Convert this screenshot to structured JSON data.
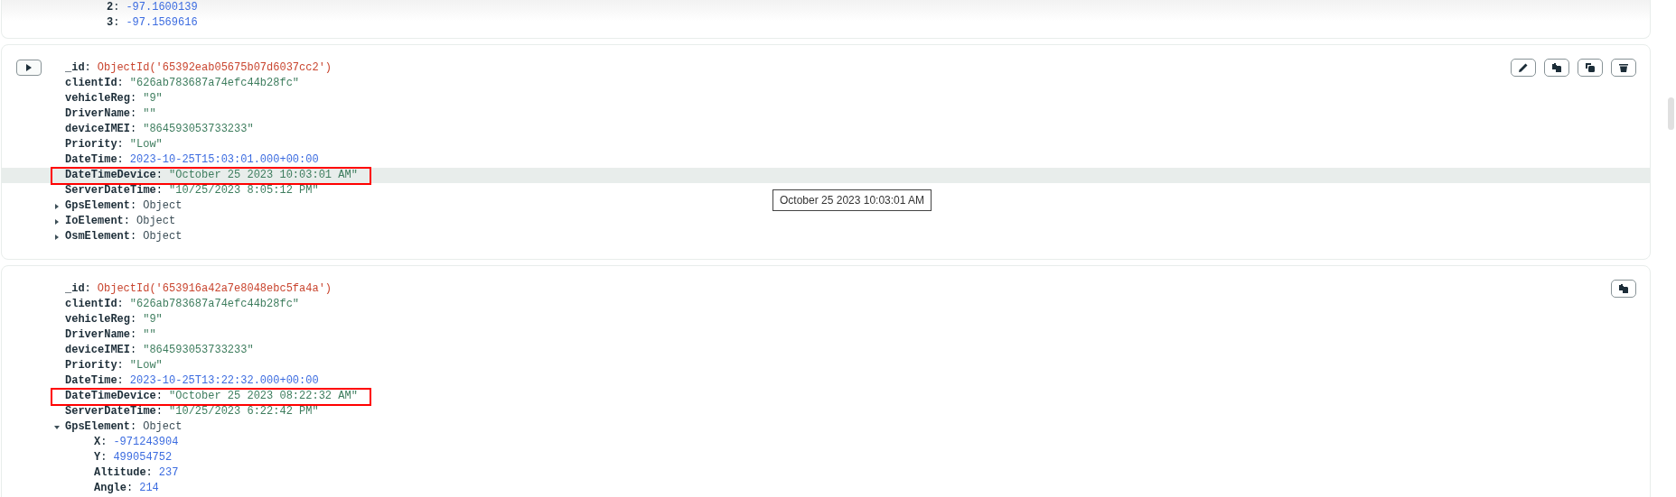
{
  "documents": [
    {
      "continued_items": [
        {
          "key": "**2**:",
          "value": "-97.1600139",
          "kind": "number"
        },
        {
          "key": "**3**:",
          "value": "-97.1569616",
          "kind": "number"
        }
      ]
    },
    {
      "expand_button": true,
      "actions": [
        {
          "kind": "edit"
        },
        {
          "kind": "copy"
        },
        {
          "kind": "clone"
        },
        {
          "kind": "delete"
        }
      ],
      "tooltip": "October 25 2023 10:03:01 AM",
      "fields": [
        {
          "key": "**_id**:",
          "value": "ObjectId('65392eab05675b07d6037cc2')",
          "kind": "objectid"
        },
        {
          "key": "**clientId**:",
          "value": "\"626ab783687a74efc44b28fc\"",
          "kind": "string"
        },
        {
          "key": "**vehicleReg**:",
          "value": "\"9\"",
          "kind": "string"
        },
        {
          "key": "**DriverName**:",
          "value": "\"\"",
          "kind": "string"
        },
        {
          "key": "**deviceIMEI**:",
          "value": "\"864593053733233\"",
          "kind": "string"
        },
        {
          "key": "**Priority**:",
          "value": "\"Low\"",
          "kind": "string"
        },
        {
          "key": "**DateTime**:",
          "value": "2023-10-25T15:03:01.000+00:00",
          "kind": "date"
        },
        {
          "key": "**DateTimeDevice**:",
          "value": "\"October 25 2023 10:03:01 AM\"",
          "kind": "string",
          "highlighted": true,
          "hovered": true
        },
        {
          "key": "**ServerDateTime**:",
          "value": "\"10/25/2023 8:05:12 PM\"",
          "kind": "string"
        },
        {
          "key": "**GpsElement**:",
          "value": "Object",
          "kind": "object",
          "expanded": false
        },
        {
          "key": "**IoElement**:",
          "value": "Object",
          "kind": "object",
          "expanded": false
        },
        {
          "key": "**OsmElement**:",
          "value": "Object",
          "kind": "object",
          "expanded": false
        }
      ]
    },
    {
      "expand_button": false,
      "actions": [
        {
          "kind": "copy"
        }
      ],
      "fields": [
        {
          "key": "**_id**:",
          "value": "ObjectId('653916a42a7e8048ebc5fa4a')",
          "kind": "objectid"
        },
        {
          "key": "**clientId**:",
          "value": "\"626ab783687a74efc44b28fc\"",
          "kind": "string"
        },
        {
          "key": "**vehicleReg**:",
          "value": "\"9\"",
          "kind": "string"
        },
        {
          "key": "**DriverName**:",
          "value": "\"\"",
          "kind": "string"
        },
        {
          "key": "**deviceIMEI**:",
          "value": "\"864593053733233\"",
          "kind": "string"
        },
        {
          "key": "**Priority**:",
          "value": "\"Low\"",
          "kind": "string"
        },
        {
          "key": "**DateTime**:",
          "value": "2023-10-25T13:22:32.000+00:00",
          "kind": "date"
        },
        {
          "key": "**DateTimeDevice**:",
          "value": "\"October 25 2023 08:22:32 AM\"",
          "kind": "string",
          "highlighted": true,
          "hovered": false
        },
        {
          "key": "**ServerDateTime**:",
          "value": "\"10/25/2023 6:22:42 PM\"",
          "kind": "string"
        },
        {
          "key": "**GpsElement**:",
          "value": "Object",
          "kind": "object",
          "expanded": true,
          "children": [
            {
              "key": "**X**:",
              "value": "-971243904",
              "kind": "number"
            },
            {
              "key": "**Y**:",
              "value": "499054752",
              "kind": "number"
            },
            {
              "key": "**Altitude**:",
              "value": "237",
              "kind": "number"
            },
            {
              "key": "**Angle**:",
              "value": "214",
              "kind": "number"
            }
          ]
        }
      ]
    }
  ]
}
